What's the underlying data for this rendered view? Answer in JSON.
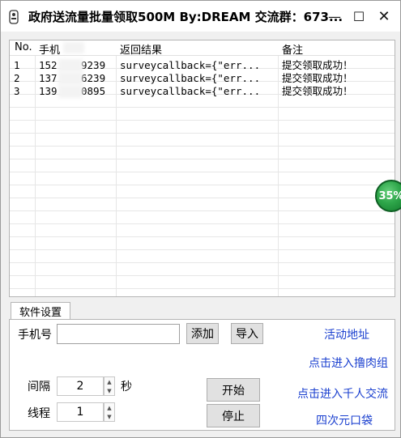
{
  "window": {
    "title": "政府送流量批量领取500M By:DREAM 交流群：673...",
    "controls": {
      "minimize": "—",
      "maximize": "☐",
      "close": "✕"
    }
  },
  "table": {
    "headers": [
      "No.",
      "手机",
      "返回结果",
      "备注"
    ],
    "rows": [
      {
        "no": "1",
        "phone": "152",
        "phone_tail": "9239",
        "result": "surveycallback={\"err...",
        "note": "提交领取成功！"
      },
      {
        "no": "2",
        "phone": "137",
        "phone_tail": "6239",
        "result": "surveycallback={\"err...",
        "note": "提交领取成功！"
      },
      {
        "no": "3",
        "phone": "139",
        "phone_tail": "0895",
        "result": "surveycallback={\"err...",
        "note": "提交领取成功！"
      }
    ]
  },
  "progress": {
    "label": "35%",
    "value": 35
  },
  "settings": {
    "tab_label": "软件设置",
    "phone_label": "手机号",
    "phone_value": "",
    "add_button": "添加",
    "import_button": "导入",
    "interval_label": "间隔",
    "interval_value": "2",
    "interval_unit": "秒",
    "threads_label": "线程",
    "threads_value": "1",
    "start_button": "开始",
    "stop_button": "停止"
  },
  "links": {
    "activity": "活动地址",
    "group1": "点击进入撸肉组",
    "group2": "点击进入千人交流",
    "shop": "四次元口袋"
  },
  "colors": {
    "link": "#1a3fcf",
    "progress": "#2ea64a"
  }
}
